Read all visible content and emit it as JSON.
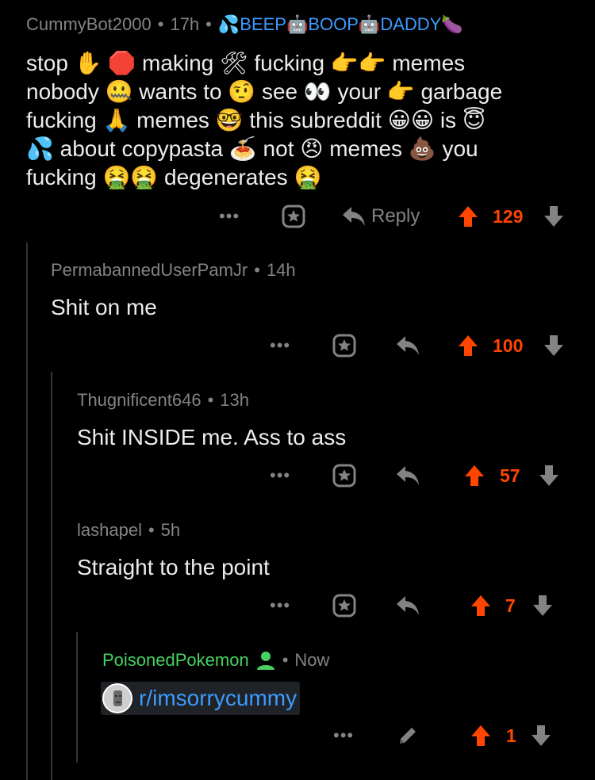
{
  "comments": [
    {
      "author": "CummyBot2000",
      "age": "17h",
      "flair": "💦BEEP🤖BOOP🤖DADDY🍆",
      "body_lines": [
        "stop ✋ 🛑 making 🛠 fucking 👉👉 memes",
        "nobody 🤐 wants to 🤨 see 👀 your 👉 garbage",
        "fucking 🙏 memes 🤓 this subreddit 😀😀 is 😇",
        "💦 about copypasta 🍝 not 😠 memes 💩 you",
        "fucking 🤮🤮 degenerates 🤮"
      ],
      "score": "129",
      "reply_label": "Reply"
    },
    {
      "author": "PermabannedUserPamJr",
      "age": "14h",
      "body": "Shit on me",
      "score": "100"
    },
    {
      "author": "Thugnificent646",
      "age": "13h",
      "body": "Shit INSIDE me. Ass to ass",
      "score": "57"
    },
    {
      "author": "lashapel",
      "age": "5h",
      "body": "Straight to the point",
      "score": "7"
    },
    {
      "author": "PoisonedPokemon",
      "age": "Now",
      "subreddit_link": "r/imsorrycummy",
      "score": "1"
    }
  ],
  "ui": {
    "more_label": "•••",
    "dot": "•",
    "accent_color": "#ff4500",
    "link_color": "#3d9bff",
    "mod_color": "#46d160"
  }
}
